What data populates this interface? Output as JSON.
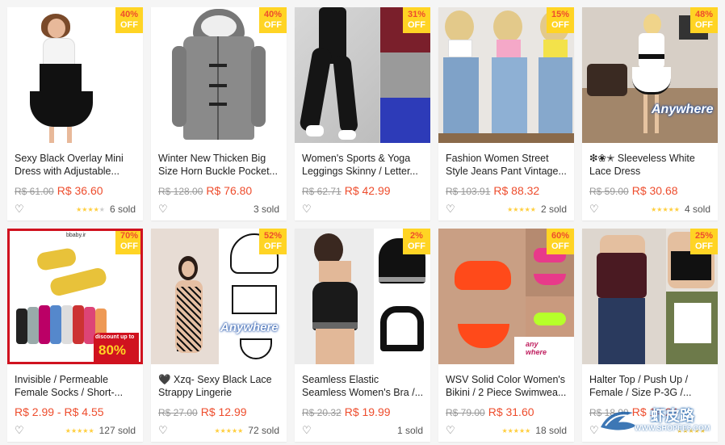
{
  "products": [
    {
      "title": "Sexy Black Overlay Mini Dress with Adjustable...",
      "old_price": "R$ 61.00",
      "price": "R$ 36.60",
      "sold": "6 sold",
      "discount": "40%",
      "off": "OFF",
      "rating": 4
    },
    {
      "title": "Winter New Thicken Big Size Horn Buckle Pocket...",
      "old_price": "R$ 128.00",
      "price": "R$ 76.80",
      "sold": "3 sold",
      "discount": "40%",
      "off": "OFF",
      "rating": 0
    },
    {
      "title": "Women's Sports & Yoga Leggings Skinny / Letter...",
      "old_price": "R$ 62.71",
      "price": "R$ 42.99",
      "sold": "",
      "discount": "31%",
      "off": "OFF",
      "rating": 0
    },
    {
      "title": "Fashion Women Street Style Jeans Pant Vintage...",
      "old_price": "R$ 103.91",
      "price": "R$ 88.32",
      "sold": "2 sold",
      "discount": "15%",
      "off": "OFF",
      "rating": 5
    },
    {
      "title": "❇❀✭ Sleeveless White Lace Dress",
      "old_price": "R$ 59.00",
      "price": "R$ 30.68",
      "sold": "4 sold",
      "discount": "48%",
      "off": "OFF",
      "rating": 5
    },
    {
      "title": "Invisible / Permeable Female Socks / Short-...",
      "old_price": "",
      "price": "R$ 2.99 - R$ 4.55",
      "sold": "127 sold",
      "discount": "70%",
      "off": "OFF",
      "rating": 5
    },
    {
      "title": "🖤 Xzq- Sexy Black Lace Strappy Lingerie",
      "old_price": "R$ 27.00",
      "price": "R$ 12.99",
      "sold": "72 sold",
      "discount": "52%",
      "off": "OFF",
      "rating": 5
    },
    {
      "title": "Seamless Elastic Seamless Women's Bra /...",
      "old_price": "R$ 20.32",
      "price": "R$ 19.99",
      "sold": "1 sold",
      "discount": "2%",
      "off": "OFF",
      "rating": 0
    },
    {
      "title": "WSV Solid Color Women's Bikini / 2 Piece Swimwea...",
      "old_price": "R$ 79.00",
      "price": "R$ 31.60",
      "sold": "18 sold",
      "discount": "60%",
      "off": "OFF",
      "rating": 5
    },
    {
      "title": "Halter Top / Push Up / Female / Size P-3G /...",
      "old_price": "R$ 18.99",
      "price": "R$ 14.24",
      "sold": "",
      "discount": "25%",
      "off": "OFF",
      "rating": 5
    }
  ],
  "image_text": {
    "anywhere": "Anywhere",
    "discount_up_to": "discount up to",
    "discount_80": "80%",
    "any_where": "any where",
    "shop_tag": "bbaby.ir"
  },
  "watermark": {
    "text": "虾皮路",
    "url": "WWW.SHOPEE6.COM"
  },
  "icons": {
    "heart": "heart-outline-icon",
    "star": "star-icon"
  },
  "colors": {
    "accent": "#ee4d2d",
    "badge": "#ffd424",
    "star": "#ffce3d"
  }
}
